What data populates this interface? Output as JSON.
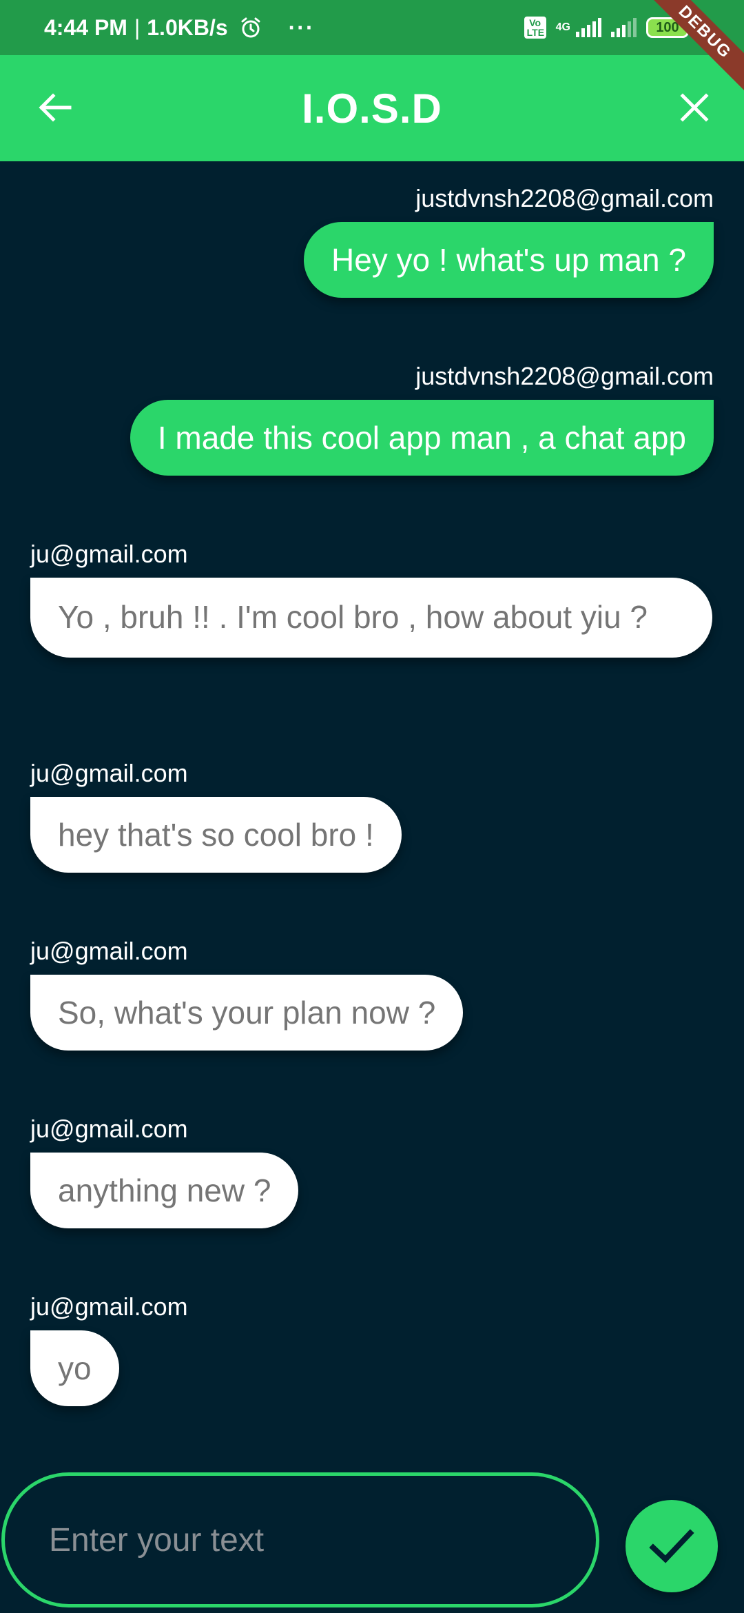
{
  "status_bar": {
    "time": "4:44 PM",
    "separator": "|",
    "speed": "1.0KB/s",
    "alarm_icon": "alarm-clock-icon",
    "more_dots": "···",
    "volte": "Vo LTE",
    "network": "4G",
    "battery": "100",
    "debug_banner": "DEBUG"
  },
  "app_bar": {
    "title": "I.O.S.D",
    "back_icon": "arrow-back-icon",
    "close_icon": "close-icon"
  },
  "messages": [
    {
      "sender": "justdvnsh2208@gmail.com",
      "text": "Hey yo ! what's up man ?",
      "mine": true
    },
    {
      "sender": "justdvnsh2208@gmail.com",
      "text": "I made this cool app man , a chat app",
      "mine": true
    },
    {
      "sender": "ju@gmail.com",
      "text": "Yo , bruh !! . I'm cool bro , how about yiu ?",
      "mine": false
    },
    {
      "sender": "ju@gmail.com",
      "text": "hey that's so cool bro !",
      "mine": false
    },
    {
      "sender": "ju@gmail.com",
      "text": "So, what's your plan now ?",
      "mine": false
    },
    {
      "sender": "ju@gmail.com",
      "text": "anything new ?",
      "mine": false
    },
    {
      "sender": "ju@gmail.com",
      "text": "yo",
      "mine": false
    }
  ],
  "composer": {
    "placeholder": "Enter your text",
    "value": "",
    "send_icon": "check-icon"
  },
  "colors": {
    "status_bar": "#229b4a",
    "accent": "#2bd66a",
    "background": "#01202f",
    "incoming_bubble": "#ffffff",
    "incoming_text": "#757575"
  }
}
